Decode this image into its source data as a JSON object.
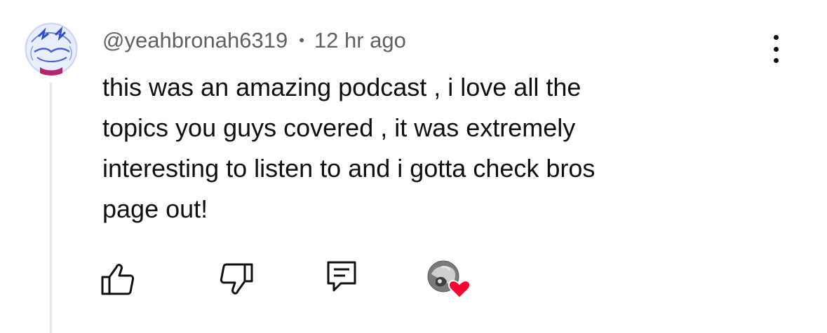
{
  "comment": {
    "author": "@yeahbronah6319",
    "separator": "•",
    "timestamp": "12 hr ago",
    "text_lines": [
      "this was an amazing podcast , i love all the",
      "topics you guys covered , it was extremely",
      "interesting to listen to and i gotta check bros",
      "page out!"
    ]
  },
  "icons": {
    "avatar": "user-avatar-illustration",
    "more": "vertical-ellipsis-icon",
    "like": "thumbs-up-icon",
    "dislike": "thumbs-down-icon",
    "reply": "reply-comment-icon",
    "creator_heart": "creator-heart-badge"
  },
  "colors": {
    "author_meta": "#606060",
    "body_text": "#0f0f0f",
    "thread_line": "#e5e5e5",
    "heart": "#ff0033"
  }
}
